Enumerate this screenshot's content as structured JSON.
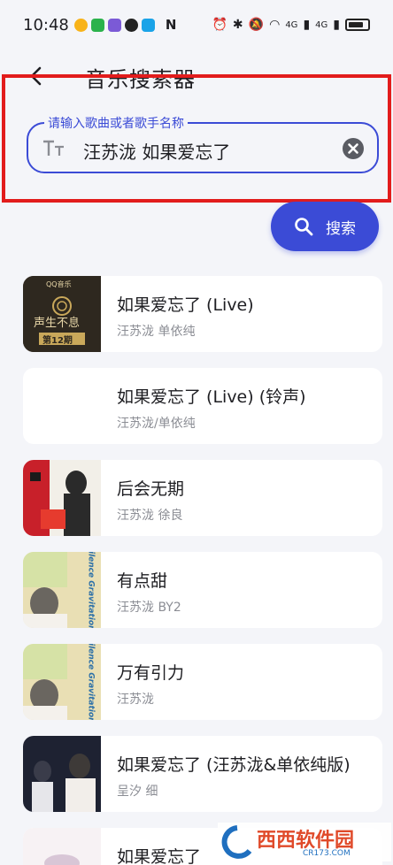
{
  "status_bar": {
    "time": "10:48",
    "nfc": "N",
    "signal1": "4G",
    "signal2": "4G"
  },
  "header": {
    "title": "音乐搜索器"
  },
  "search": {
    "label": "请输入歌曲或者歌手名称",
    "value": "汪苏泷 如果爱忘了",
    "button_label": "搜索"
  },
  "songs": [
    {
      "title": "如果爱忘了 (Live)",
      "artist": "汪苏泷 单依纯",
      "cover": "qqmusic-show"
    },
    {
      "title": "如果爱忘了 (Live) (铃声)",
      "artist": "汪苏泷/单依纯",
      "cover": "none"
    },
    {
      "title": "后会无期",
      "artist": "汪苏泷 徐良",
      "cover": "red-album"
    },
    {
      "title": "有点甜",
      "artist": "汪苏泷 BY2",
      "cover": "silence-album"
    },
    {
      "title": "万有引力",
      "artist": "汪苏泷",
      "cover": "silence-album"
    },
    {
      "title": "如果爱忘了 (汪苏泷&单依纯版)",
      "artist": "呈汐 细",
      "cover": "photo-album"
    },
    {
      "title": "如果爱忘了",
      "artist": "",
      "cover": "pink-album"
    }
  ],
  "covers": {
    "qqmusic_brand": "QQ音乐",
    "qqmusic_show": "声生不息",
    "qqmusic_episode": "第12期",
    "silence_text": "Silence Gravitation"
  },
  "watermark": {
    "text": "西西软件园",
    "url_text": "CR173.COM"
  },
  "colors": {
    "accent": "#3b4bd6",
    "highlight": "#e21c1c",
    "background": "#f4f5f9"
  }
}
